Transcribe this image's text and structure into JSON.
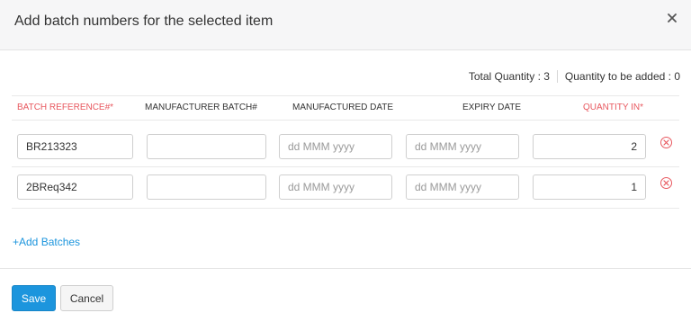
{
  "dialog": {
    "title": "Add batch numbers for the selected item",
    "close_icon": "close-icon"
  },
  "summary": {
    "total_quantity": "Total Quantity : 3",
    "to_be_added": "Quantity to be added : 0"
  },
  "columns": [
    {
      "label": "BATCH REFERENCE#*",
      "required": true
    },
    {
      "label": "MANUFACTURER BATCH#",
      "required": false
    },
    {
      "label": "MANUFACTURED DATE",
      "required": false
    },
    {
      "label": "EXPIRY DATE",
      "required": false
    },
    {
      "label": "QUANTITY IN*",
      "required": true
    }
  ],
  "rows": [
    {
      "batch_reference": "BR213323",
      "manufacturer_batch": "",
      "manufactured_date_placeholder": "dd MMM yyyy",
      "expiry_date_placeholder": "dd MMM yyyy",
      "quantity": "2"
    },
    {
      "batch_reference": "2BReq342",
      "manufacturer_batch": "",
      "manufactured_date_placeholder": "dd MMM yyyy",
      "expiry_date_placeholder": "dd MMM yyyy",
      "quantity": "1"
    }
  ],
  "add_batches_label": "+Add Batches",
  "buttons": {
    "save": "Save",
    "cancel": "Cancel"
  },
  "colors": {
    "accent": "#1c95dd",
    "required": "#e8585f",
    "header_bg": "#f6f6f7"
  }
}
